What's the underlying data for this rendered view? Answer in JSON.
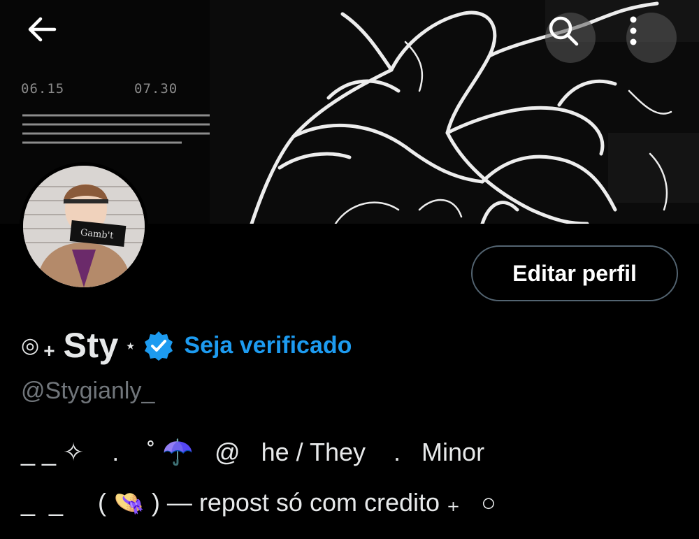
{
  "banner": {
    "date_left": "06.15",
    "date_right": "07.30"
  },
  "toolbar": {
    "back_icon": "arrow-left-icon",
    "search_icon": "search-icon",
    "more_icon": "more-vertical-icon"
  },
  "profile": {
    "avatar_caption": "Gamb't",
    "edit_button_label": "Editar perfil",
    "name_prefix": "◎",
    "name_plus": "+",
    "display_name": "Sty",
    "name_suffix": "⋆",
    "verify_link": "Seja verificado",
    "handle": "@Stygianly_",
    "bio_line_1": "_ _ ✧    .    ˚ ☂️   @   he / They    .   Minor",
    "bio_line_2": "_  _     ( 👒 ) — repost só com credito ₊   ○"
  },
  "colors": {
    "background": "#000000",
    "accent": "#1d9bf0",
    "secondary_text": "#71767b",
    "border": "#536471"
  }
}
